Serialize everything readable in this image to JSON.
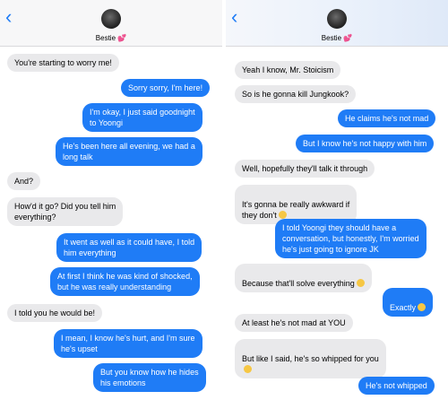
{
  "left": {
    "back_label": "‹",
    "contact_name": "Bestie",
    "heart": "💕",
    "messages": [
      {
        "dir": "in",
        "text": "You're starting to worry me!"
      },
      {
        "dir": "out",
        "text": "Sorry sorry, I'm here!"
      },
      {
        "dir": "out",
        "text": "I'm okay, I just said goodnight\nto Yoongi"
      },
      {
        "dir": "out",
        "text": "He's been here all evening, we had a\nlong talk"
      },
      {
        "dir": "in",
        "text": "And?"
      },
      {
        "dir": "in",
        "text": "How'd it go? Did you tell him\neverything?"
      },
      {
        "dir": "out",
        "text": "It went as well as it could have, I told\nhim everything"
      },
      {
        "dir": "out",
        "text": "At first I think he was kind of shocked,\nbut he was really understanding"
      },
      {
        "dir": "in",
        "text": "I told you he would be!"
      },
      {
        "dir": "out",
        "text": "I mean, I know he's hurt, and I'm sure\nhe's upset"
      },
      {
        "dir": "out",
        "text": "But you know how he hides\nhis emotions"
      }
    ]
  },
  "right": {
    "back_label": "‹",
    "contact_name": "Bestie",
    "heart": "💕",
    "messages": [
      {
        "dir": "in",
        "text": "Yeah I know, Mr. Stoicism"
      },
      {
        "dir": "in",
        "text": "So is he gonna kill Jungkook?"
      },
      {
        "dir": "out",
        "text": "He claims he's not mad"
      },
      {
        "dir": "out",
        "text": "But I know he's not happy with him"
      },
      {
        "dir": "in",
        "text": "Well, hopefully they'll talk it through"
      },
      {
        "dir": "in",
        "text": "It's gonna be really awkward if\nthey don't",
        "emoji": true
      },
      {
        "dir": "out",
        "text": "I told Yoongi they should have a\nconversation, but honestly, I'm worried\nhe's just going to ignore JK"
      },
      {
        "dir": "in",
        "text": "Because that'll solve everything",
        "emoji": true
      },
      {
        "dir": "out",
        "text": "Exactly",
        "emoji": true
      },
      {
        "dir": "in",
        "text": "At least he's not mad at YOU"
      },
      {
        "dir": "in",
        "text": "But like I said, he's so whipped for you\n",
        "emoji": true
      },
      {
        "dir": "out",
        "text": "He's not whipped"
      }
    ]
  }
}
